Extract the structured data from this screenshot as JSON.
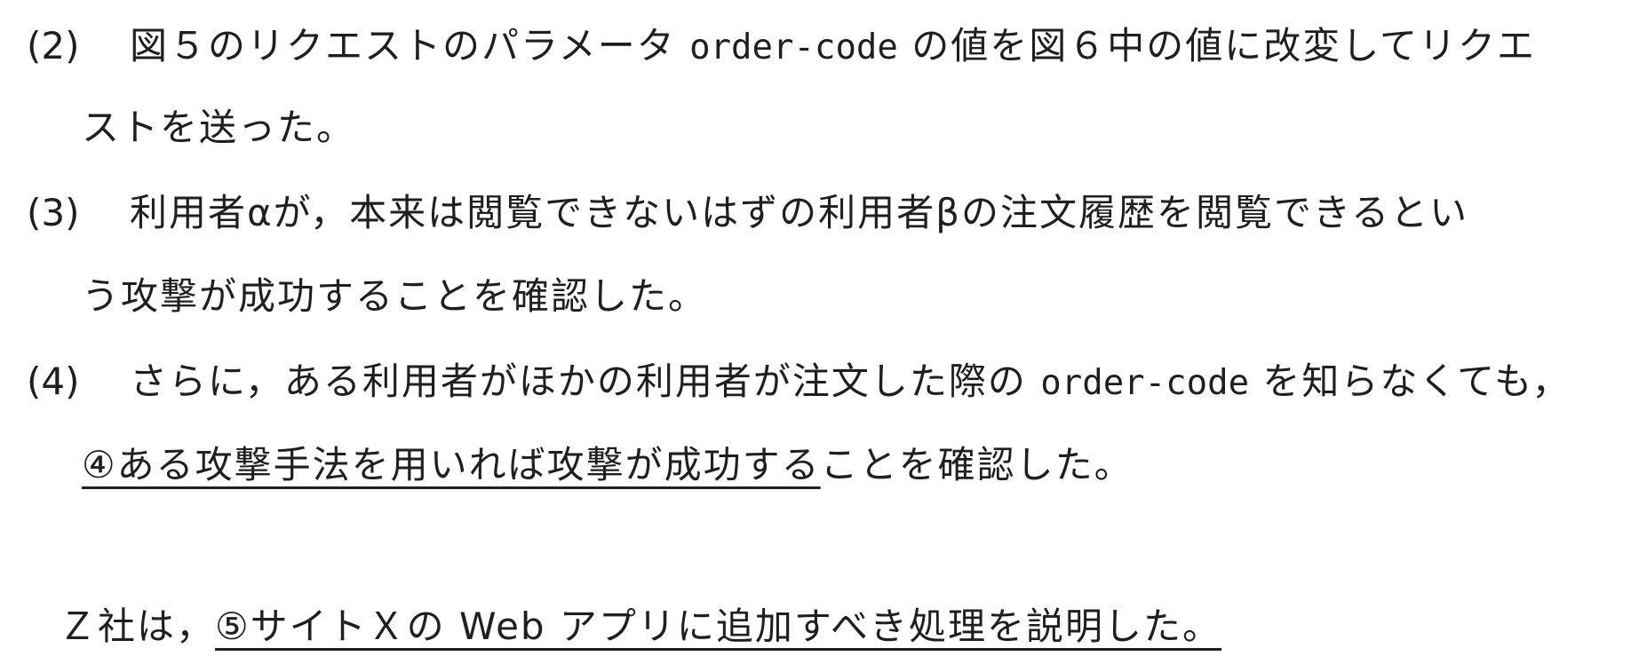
{
  "items": [
    {
      "number": "(2)",
      "line1_a": "図５のリクエストのパラメータ ",
      "line1_code": "order-code",
      "line1_b": " の値を図６中の値に改変してリクエ",
      "line2": "ストを送った。"
    },
    {
      "number": "(3)",
      "line1": "利用者αが，本来は閲覧できないはずの利用者βの注文履歴を閲覧できるとい",
      "line2": "う攻撃が成功することを確認した。"
    },
    {
      "number": "(4)",
      "line1_a": "さらに，ある利用者がほかの利用者が注文した際の ",
      "line1_code": "order-code",
      "line1_b": " を知らなくても，",
      "line2_underlined": "④ある攻撃手法を用いれば攻撃が成功する",
      "line2_rest": "ことを確認した。"
    }
  ],
  "closing": {
    "prefix": "Ｚ社は，",
    "underlined": "⑤サイトＸの Web アプリに追加すべき処理を説明した。"
  }
}
